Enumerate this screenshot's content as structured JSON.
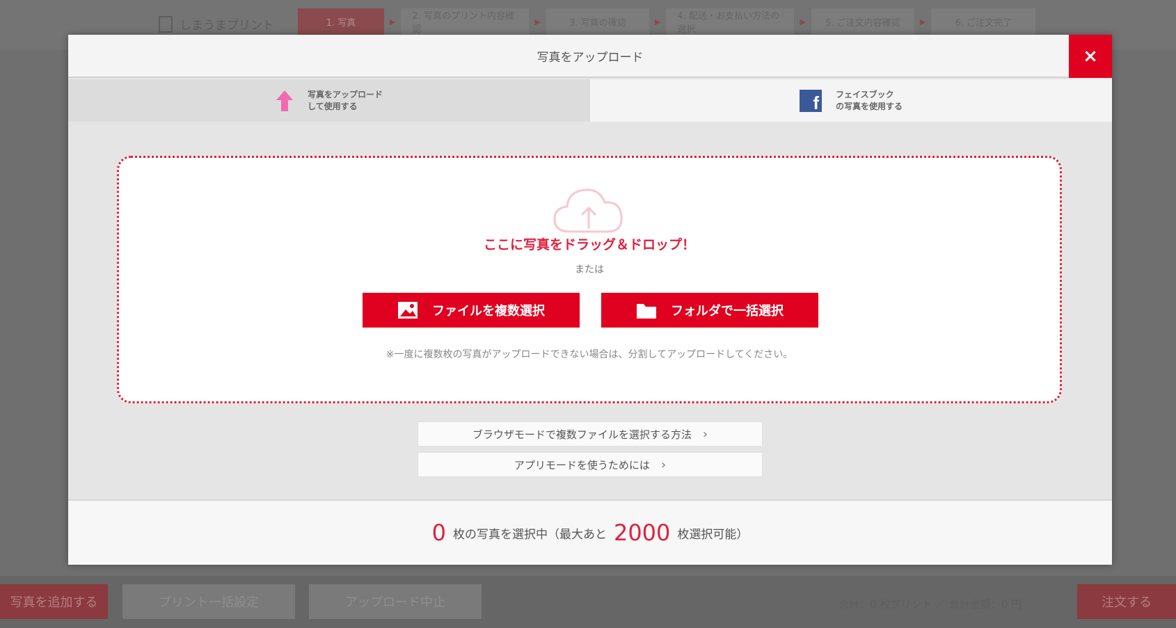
{
  "background": {
    "logo_text": "しまうまプリント",
    "steps": [
      "1. 写真",
      "2. 写真のプリント内容確認",
      "3. 写真の確認",
      "4. 配送・お支払い方法の選択",
      "5. ご注文内容確認",
      "6. ご注文完了"
    ],
    "footer_buttons": {
      "add": "写真を追加する",
      "bulk_settings": "プリント一括設定",
      "upload_status": "アップロード中止"
    },
    "footer_total": "合計：0 枚プリント ／ 合計金額：0 円",
    "order_button": "注文する"
  },
  "modal": {
    "title": "写真をアップロード",
    "close_label": "×",
    "tabs": {
      "upload": {
        "line1": "写真をアップロード",
        "line2": "して使用する"
      },
      "facebook": {
        "line1": "フェイスブック",
        "line2": "の写真を使用する"
      }
    },
    "dropzone": {
      "title": "ここに写真をドラッグ＆ドロップ！",
      "or_text": "または",
      "file_button": "ファイルを複数選択",
      "folder_button": "フォルダで一括選択",
      "note": "※一度に複数枚の写真がアップロードできない場合は、分割してアップロードしてください。"
    },
    "links": {
      "browser_mode": "ブラウザモードで複数ファイルを選択する方法",
      "app_mode": "アプリモードを使うためには"
    },
    "footer": {
      "selected_count": "0",
      "selected_text": "枚の写真を選択中（最大あと",
      "remaining_count": "2000",
      "remaining_text": "枚選択可能）"
    }
  },
  "colors": {
    "accent": "#e0001f",
    "facebook": "#3b5998",
    "upload_arrow": "#f06ab0"
  }
}
